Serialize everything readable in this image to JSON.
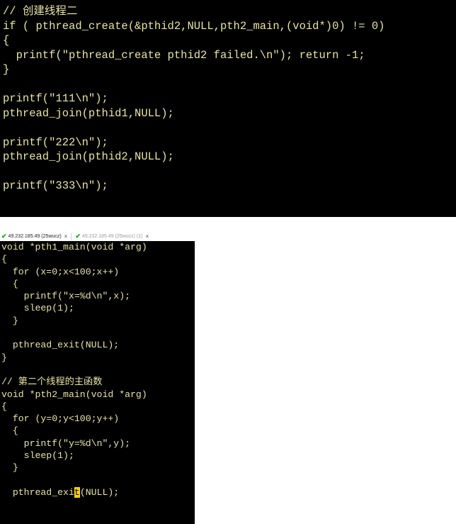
{
  "top_editor": {
    "lines": [
      "// 创建线程二",
      "if ( pthread_create(&pthid2,NULL,pth2_main,(void*)0) != 0)",
      "{",
      "  printf(\"pthread_create pthid2 failed.\\n\"); return -1;",
      "}",
      "",
      "printf(\"111\\n\");",
      "pthread_join(pthid1,NULL);",
      "",
      "printf(\"222\\n\");",
      "pthread_join(pthid2,NULL);",
      "",
      "printf(\"333\\n\");"
    ]
  },
  "terminal_tabs": [
    {
      "label": "49.232.185.49 (25wucz)",
      "active": true,
      "close": "×"
    },
    {
      "label": "49.232.185.49 (25wucz) (1)",
      "active": false,
      "close": "×"
    }
  ],
  "bottom_editor": {
    "lines": [
      "void *pth1_main(void *arg)",
      "{",
      "  for (x=0;x<100;x++)",
      "  {",
      "    printf(\"x=%d\\n\",x);",
      "    sleep(1);",
      "  }",
      "",
      "  pthread_exit(NULL);",
      "}",
      "",
      "// 第二个线程的主函数",
      "void *pth2_main(void *arg)",
      "{",
      "  for (y=0;y<100;y++)",
      "  {",
      "    printf(\"y=%d\\n\",y);",
      "    sleep(1);",
      "  }",
      "",
      "  pthread_exi"
    ],
    "cursor_char": "t",
    "after_cursor": "(NULL);"
  },
  "colors": {
    "background": "#000000",
    "code_text": "#e8e3a6",
    "cursor": "#ffd400",
    "connected_check": "#1aa11a"
  }
}
